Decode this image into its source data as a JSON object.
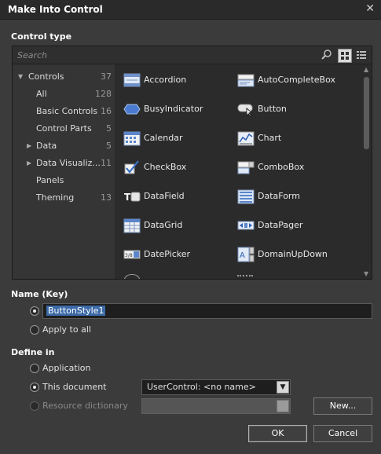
{
  "window": {
    "title": "Make Into Control",
    "close_glyph": "✕"
  },
  "control_type": {
    "label": "Control type",
    "search_placeholder": "Search",
    "tree": [
      {
        "label": "Controls",
        "count": "37",
        "expanded": true,
        "level": 0
      },
      {
        "label": "All",
        "count": "128",
        "level": 1
      },
      {
        "label": "Basic Controls",
        "count": "16",
        "level": 1
      },
      {
        "label": "Control Parts",
        "count": "5",
        "level": 1
      },
      {
        "label": "Data",
        "count": "5",
        "level": 1,
        "collapsed": true
      },
      {
        "label": "Data Visualiz...",
        "count": "11",
        "level": 1,
        "collapsed": true
      },
      {
        "label": "Panels",
        "count": "",
        "level": 1
      },
      {
        "label": "Theming",
        "count": "13",
        "level": 1
      }
    ],
    "items": [
      {
        "label": "Accordion",
        "icon": "accordion-icon"
      },
      {
        "label": "AutoCompleteBox",
        "icon": "autocompletebox-icon"
      },
      {
        "label": "BusyIndicator",
        "icon": "busyindicator-icon"
      },
      {
        "label": "Button",
        "icon": "button-icon"
      },
      {
        "label": "Calendar",
        "icon": "calendar-icon"
      },
      {
        "label": "Chart",
        "icon": "chart-icon"
      },
      {
        "label": "CheckBox",
        "icon": "checkbox-icon"
      },
      {
        "label": "ComboBox",
        "icon": "combobox-icon"
      },
      {
        "label": "DataField",
        "icon": "datafield-icon"
      },
      {
        "label": "DataForm",
        "icon": "dataform-icon"
      },
      {
        "label": "DataGrid",
        "icon": "datagrid-icon"
      },
      {
        "label": "DataPager",
        "icon": "datapager-icon"
      },
      {
        "label": "DatePicker",
        "icon": "datepicker-icon"
      },
      {
        "label": "DomainUpDown",
        "icon": "domainupdown-icon"
      }
    ]
  },
  "name_key": {
    "label": "Name (Key)",
    "value": "ButtonStyle1",
    "apply_all_label": "Apply to all"
  },
  "define_in": {
    "label": "Define in",
    "application_label": "Application",
    "this_document_label": "This document",
    "this_document_value": "UserControl: <no name>",
    "resource_dictionary_label": "Resource dictionary",
    "new_button": "New..."
  },
  "buttons": {
    "ok": "OK",
    "cancel": "Cancel"
  }
}
